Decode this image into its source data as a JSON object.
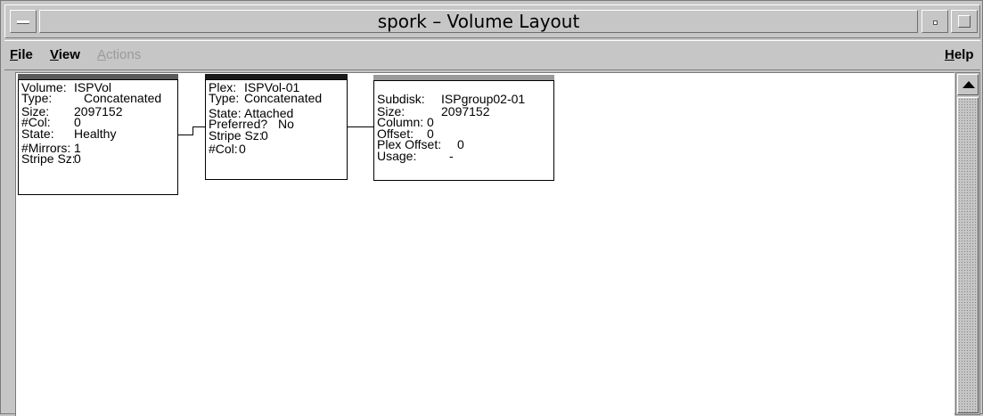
{
  "window": {
    "title": "spork – Volume Layout"
  },
  "menubar": {
    "file": {
      "label": "File"
    },
    "view": {
      "label": "View"
    },
    "actions": {
      "label": "Actions"
    },
    "help": {
      "label": "Help"
    }
  },
  "volume": {
    "header_color": "#5a5a5a",
    "name_label": "Volume:",
    "name": "ISPVol",
    "type_label": "Type:",
    "type": "Concatenated",
    "size_label": "Size:",
    "size": "2097152",
    "col_label": "#Col:",
    "col": "0",
    "state_label": "State:",
    "state": "Healthy",
    "mirrors_label": "#Mirrors:",
    "mirrors": "1",
    "stripe_label": "Stripe Sz:",
    "stripe": "0"
  },
  "plex": {
    "header_color": "#1a1a1a",
    "name_label": "Plex:",
    "name": "ISPVol-01",
    "type_label": "Type:",
    "type": "Concatenated",
    "state_label": "State:",
    "state": "Attached",
    "preferred_label": "Preferred?",
    "preferred": "No",
    "stripe_label": "Stripe Sz:",
    "stripe": "0",
    "col_label": "#Col:",
    "col": "0"
  },
  "subdisk": {
    "header_color": "#9a9a9a",
    "name_label": "Subdisk:",
    "name": "ISPgroup02-01",
    "size_label": "Size:",
    "size": "2097152",
    "column_label": "Column:",
    "column": "0",
    "offset_label": "Offset:",
    "offset": "0",
    "plex_offset_label": "Plex Offset:",
    "plex_offset": "0",
    "usage_label": "Usage:",
    "usage": "-"
  }
}
